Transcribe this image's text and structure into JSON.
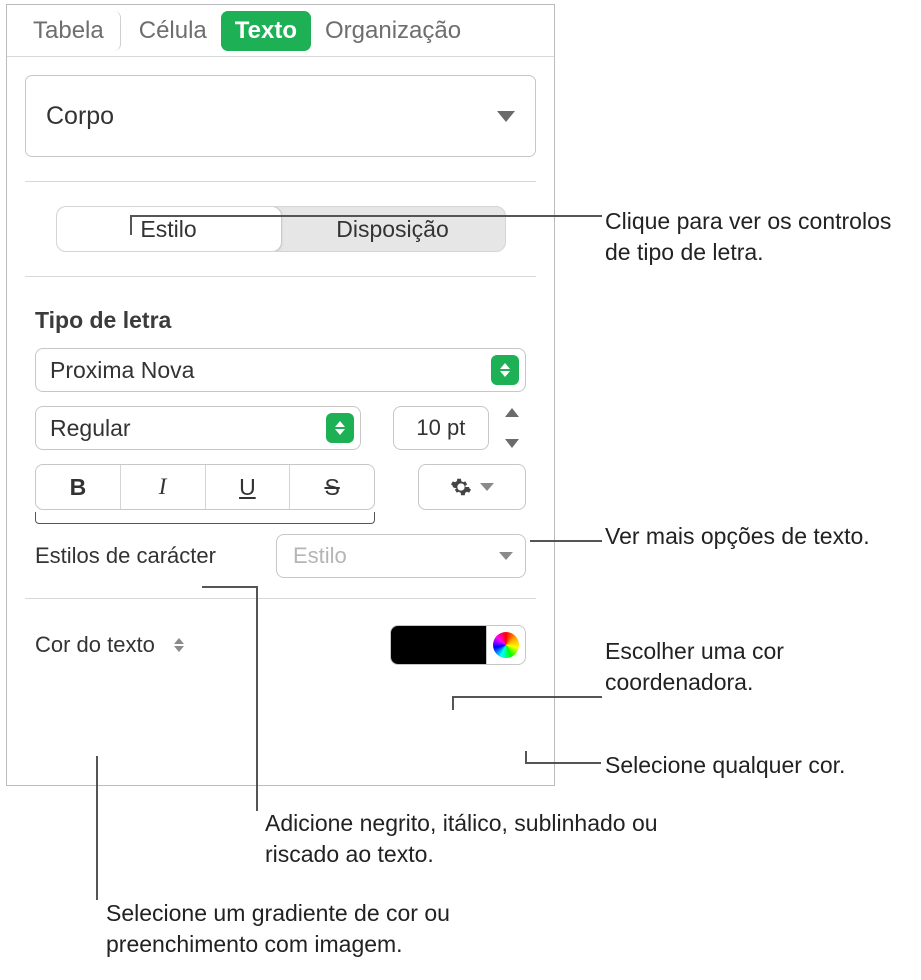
{
  "tabs": {
    "table": "Tabela",
    "cell": "Célula",
    "text": "Texto",
    "organization": "Organização"
  },
  "paragraph_style": "Corpo",
  "segmented": {
    "style": "Estilo",
    "layout": "Disposição"
  },
  "font": {
    "section_label": "Tipo de letra",
    "family": "Proxima Nova",
    "weight": "Regular",
    "size": "10 pt",
    "bold": "B",
    "italic": "I",
    "underline": "U",
    "strike": "S"
  },
  "char_styles": {
    "label": "Estilos de carácter",
    "placeholder": "Estilo"
  },
  "text_color": {
    "label": "Cor do texto",
    "swatch": "#000000"
  },
  "callouts": {
    "style_tab": "Clique para ver os controlos de tipo de letra.",
    "gear": "Ver mais opções de texto.",
    "swatch": "Escolher uma cor coordenadora.",
    "wheel": "Selecione qualquer cor.",
    "bius": "Adicione negrito, itálico, sublinhado ou riscado ao texto.",
    "color_label": "Selecione um gradiente de cor ou preenchimento com imagem."
  }
}
